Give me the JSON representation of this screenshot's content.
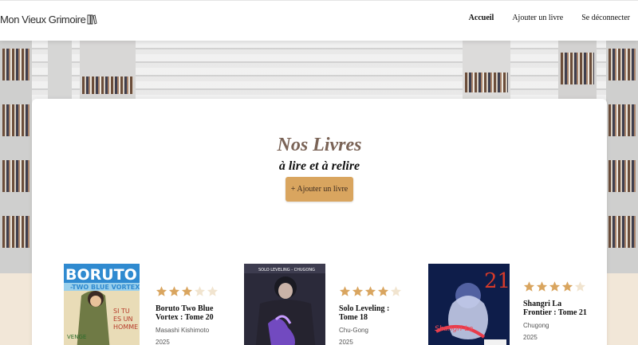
{
  "header": {
    "logo_text": "Mon Vieux Grimoire",
    "nav": [
      {
        "label": "Accueil",
        "active": true
      },
      {
        "label": "Ajouter un livre",
        "active": false
      },
      {
        "label": "Se déconnecter",
        "active": false
      }
    ]
  },
  "hero": {
    "title": "Nos Livres",
    "subtitle": "à lire et à relire",
    "add_button": "+ Ajouter un livre"
  },
  "books": [
    {
      "title": "Boruto Two Blue Vortex : Tome 20",
      "author": "Masashi Kishimoto",
      "year": "2025",
      "rating": 3
    },
    {
      "title": "Solo Leveling : Tome 18",
      "author": "Chu-Gong",
      "year": "2025",
      "rating": 4
    },
    {
      "title": "Shangri La Frontier : Tome 21",
      "author": "Chugong",
      "year": "2025",
      "rating": 4
    }
  ],
  "colors": {
    "accent": "#d9a55f",
    "star_filled": "#d9a55f",
    "star_empty": "#f1e4cf",
    "title": "#7a6356"
  },
  "icons": {
    "logo": "book-icon",
    "star": "star-icon"
  }
}
